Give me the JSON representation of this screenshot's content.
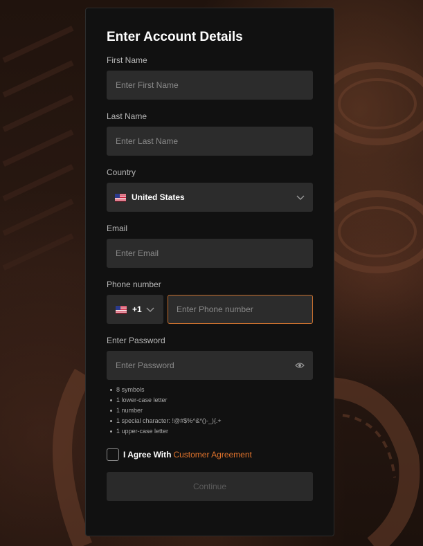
{
  "form": {
    "title": "Enter Account Details",
    "first_name": {
      "label": "First Name",
      "placeholder": "Enter First Name",
      "value": ""
    },
    "last_name": {
      "label": "Last Name",
      "placeholder": "Enter Last Name",
      "value": ""
    },
    "country": {
      "label": "Country",
      "selected": "United States",
      "flag": "us-flag-icon"
    },
    "email": {
      "label": "Email",
      "placeholder": "Enter Email",
      "value": ""
    },
    "phone": {
      "label": "Phone number",
      "code": "+1",
      "code_flag": "us-flag-icon",
      "placeholder": "Enter Phone number",
      "value": ""
    },
    "password": {
      "label": "Enter Password",
      "placeholder": "Enter Password",
      "value": "",
      "rules": [
        "8 symbols",
        "1 lower-case letter",
        "1 number",
        "1 special character: !@#$%^&*()-_){.+",
        "1 upper-case letter"
      ]
    },
    "agreement": {
      "text": "I Agree With",
      "link": "Customer Agreement",
      "checked": false
    },
    "continue_label": "Continue"
  },
  "colors": {
    "accent": "#e0732c",
    "card_bg": "#111111",
    "input_bg": "#2c2c2c",
    "focus_border": "#c9702e"
  }
}
